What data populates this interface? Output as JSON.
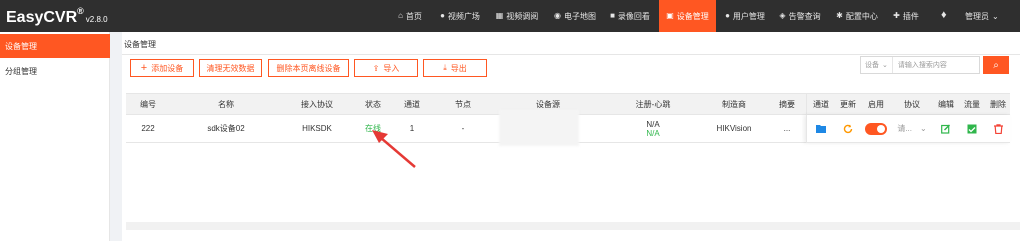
{
  "app": {
    "name": "EasyCVR",
    "reg": "®",
    "version": "v2.8.0"
  },
  "topnav": [
    {
      "label": "首页",
      "icon": "home-icon",
      "glyph": "⌂",
      "active": false
    },
    {
      "label": "视频广场",
      "icon": "play-circle-icon",
      "glyph": "●",
      "active": false
    },
    {
      "label": "视频调阅",
      "icon": "grid-icon",
      "glyph": "▦",
      "active": false
    },
    {
      "label": "电子地图",
      "icon": "map-pin-icon",
      "glyph": "◉",
      "active": false
    },
    {
      "label": "录像回看",
      "icon": "video-camera-icon",
      "glyph": "■",
      "active": false
    },
    {
      "label": "设备管理",
      "icon": "device-icon",
      "glyph": "▣",
      "active": true
    },
    {
      "label": "用户管理",
      "icon": "user-icon",
      "glyph": "●",
      "active": false
    },
    {
      "label": "告警查询",
      "icon": "alarm-icon",
      "glyph": "◈",
      "active": false
    },
    {
      "label": "配置中心",
      "icon": "gear-icon",
      "glyph": "✱",
      "active": false
    },
    {
      "label": "插件",
      "icon": "puzzle-icon",
      "glyph": "✚",
      "active": false
    }
  ],
  "user": {
    "label": "管理员",
    "icon": "chevron-down-icon",
    "glyph": "⌄"
  },
  "bell": {
    "icon": "bell-icon",
    "glyph": "🔔"
  },
  "sidebar": {
    "items": [
      {
        "label": "设备管理",
        "active": true
      },
      {
        "label": "分组管理",
        "active": false
      }
    ]
  },
  "page": {
    "title": "设备管理"
  },
  "toolbar": {
    "buttons": [
      {
        "label": "添加设备",
        "icon": "plus-icon",
        "glyph": "+"
      },
      {
        "label": "清理无效数据",
        "icon": "",
        "glyph": ""
      },
      {
        "label": "删除本页离线设备",
        "icon": "",
        "glyph": ""
      },
      {
        "label": "导入",
        "icon": "upload-icon",
        "glyph": "⇪"
      },
      {
        "label": "导出",
        "icon": "download-icon",
        "glyph": "⤓"
      }
    ]
  },
  "search": {
    "select_value": "设备",
    "select_icon": "chevron-down-icon",
    "placeholder": "请输入搜索内容",
    "button_icon": "search-icon",
    "button_glyph": "⌕"
  },
  "table": {
    "columns": [
      "编号",
      "名称",
      "接入协议",
      "状态",
      "通道",
      "节点",
      "设备源",
      "注册-心跳",
      "制造商",
      "摘要"
    ],
    "fixed_columns": [
      "通道",
      "更新",
      "启用",
      "协议",
      "编辑",
      "流量",
      "删除"
    ],
    "rows": [
      {
        "id": "222",
        "name": "sdk设备02",
        "protocol": "HIKSDK",
        "status": "在线",
        "channels": "1",
        "node": "-",
        "source": "",
        "register": "N/A",
        "heartbeat": "N/A",
        "manufacturer": "HIKVision",
        "summary": "...",
        "enabled": true,
        "protocol_select": "请..."
      }
    ]
  },
  "colors": {
    "accent": "#ff5722",
    "topbar": "#2f2f2f",
    "online": "#2fb64b",
    "channel_icon": "#1e88e5",
    "update_icon": "#ff9800",
    "edit_icon": "#2fb64b",
    "traffic_icon": "#2fb64b",
    "delete_icon": "#f44336"
  }
}
